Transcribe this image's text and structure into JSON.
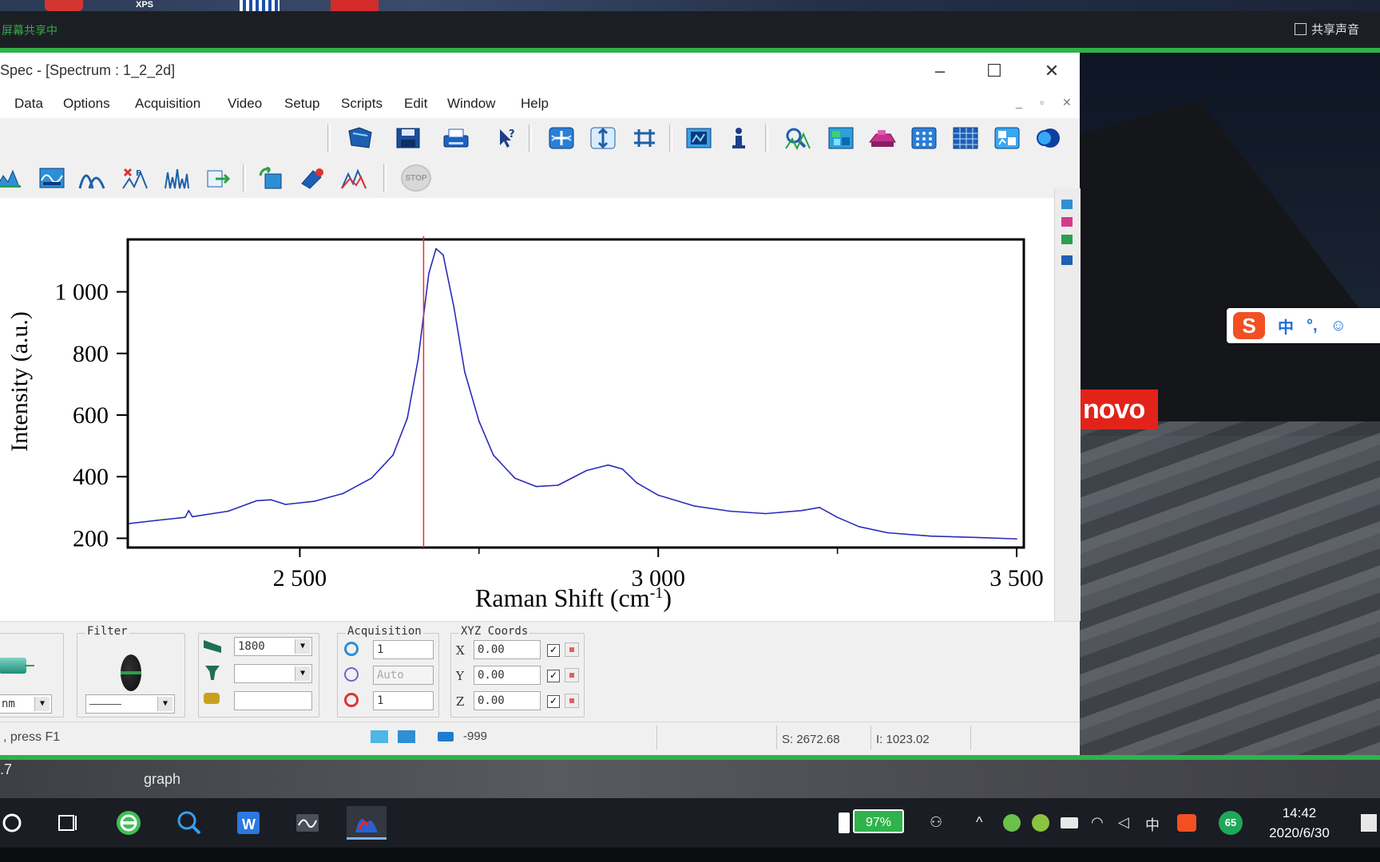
{
  "share_bar": {
    "status_text": "屏幕共享中",
    "share_sound_label": "共享声音",
    "top_thumbs": [
      "XPS"
    ]
  },
  "window": {
    "title": "Spec - [Spectrum : 1_2_2d]",
    "minimize_glyph": "–",
    "maximize_glyph": "☐",
    "close_glyph": "✕"
  },
  "menu": {
    "items": [
      "Data",
      "Options",
      "Acquisition",
      "Video",
      "Setup",
      "Scripts",
      "Edit",
      "Window",
      "Help"
    ],
    "mdi_controls": [
      "_",
      "▫",
      "✕"
    ]
  },
  "toolbar": {
    "stop_label": "STOP"
  },
  "chart_data": {
    "type": "line",
    "xlabel": "Raman Shift (cm⁻¹)",
    "xlabel_main": "Raman Shift (cm",
    "xlabel_sup": "-1",
    "xlabel_tail": ")",
    "ylabel": "Intensity (a.u.)",
    "xlim": [
      2260,
      3510
    ],
    "ylim": [
      170,
      1170
    ],
    "x_ticks": [
      2500,
      3000,
      3500
    ],
    "x_tick_labels": [
      "2 500",
      "3 000",
      "3 500"
    ],
    "x_minor_ticks": [
      2250,
      2750,
      3250
    ],
    "y_ticks": [
      200,
      400,
      600,
      800,
      1000
    ],
    "y_tick_labels": [
      "200",
      "400",
      "600",
      "800",
      "1 000"
    ],
    "cursor_x": 2672.68,
    "line_color": "#2b2bb8",
    "cursor_color": "#e03030",
    "series": [
      {
        "x": [
          2255,
          2300,
          2340,
          2345,
          2350,
          2400,
          2440,
          2460,
          2480,
          2520,
          2560,
          2600,
          2630,
          2650,
          2665,
          2680,
          2690,
          2700,
          2715,
          2730,
          2750,
          2770,
          2800,
          2830,
          2860,
          2900,
          2930,
          2950,
          2970,
          3000,
          3050,
          3100,
          3150,
          3200,
          3225,
          3250,
          3280,
          3320,
          3380,
          3450,
          3500
        ],
        "y": [
          248,
          258,
          268,
          290,
          270,
          288,
          322,
          325,
          310,
          320,
          345,
          395,
          470,
          590,
          780,
          1060,
          1140,
          1120,
          950,
          740,
          580,
          470,
          395,
          368,
          372,
          420,
          438,
          425,
          380,
          340,
          305,
          288,
          280,
          290,
          300,
          268,
          238,
          218,
          207,
          202,
          198
        ]
      }
    ]
  },
  "hardware": {
    "filter_legend": "Filter",
    "acquisition_legend": "Acquisition",
    "xyz_legend": "XYZ Coords",
    "grating_value": "1800",
    "laser_unit": "nm",
    "acq_time": "1",
    "acq_auto": "Auto",
    "acq_accum": "1",
    "x_label": "X",
    "y_label": "Y",
    "z_label": "Z",
    "x_value": "0.00",
    "y_value": "0.00",
    "z_value": "0.00",
    "check_glyph": "✓"
  },
  "statusbar": {
    "help_text": ", press F1",
    "value_minus": "-999",
    "s_readout": "S: 2672.68",
    "i_readout": "I: 1023.02"
  },
  "desktop_labels": {
    "left_number": ".7",
    "graph_label": "graph"
  },
  "taskbar": {
    "battery_text": "97%",
    "ime_lang": "中",
    "tray_badge": "65",
    "time": "14:42",
    "date": "2020/6/30"
  },
  "ime_toolbar": {
    "logo_letter": "S",
    "lang": "中",
    "punct": "°,"
  },
  "wallpaper": {
    "brand_text": "novo"
  },
  "colors": {
    "share_green": "#2fb34a",
    "lenovo_red": "#e2231a",
    "toolbar_bg": "#f0f0f0"
  }
}
